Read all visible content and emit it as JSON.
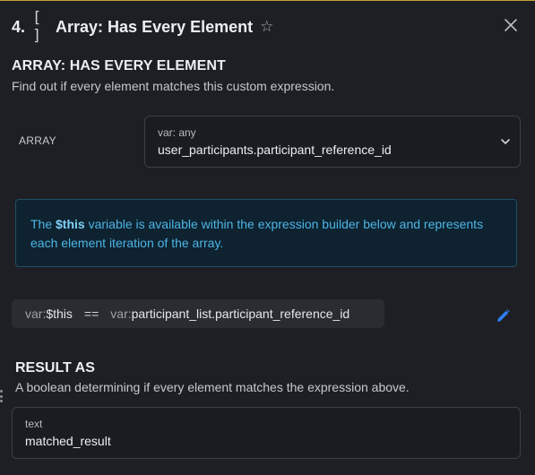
{
  "header": {
    "step_number": "4.",
    "bracket_icon": "[ ]",
    "title": "Array: Has Every Element",
    "star_icon": "star-outline-icon",
    "close_icon": "close-icon"
  },
  "section": {
    "title": "ARRAY: HAS EVERY ELEMENT",
    "description": "Find out if every element matches this custom expression."
  },
  "array_field": {
    "label": "ARRAY",
    "type_hint": "var: any",
    "value": "user_participants.participant_reference_id"
  },
  "info": {
    "prefix": "The ",
    "highlight": "$this",
    "suffix": " variable is available within the expression builder below and represents each element iteration of the array."
  },
  "expression": {
    "left_prefix": "var:",
    "left_value": "$this",
    "operator": "==",
    "right_prefix": "var:",
    "right_value": "participant_list.participant_reference_id"
  },
  "result": {
    "title": "RESULT AS",
    "description": "A boolean determining if every element matches the expression above.",
    "type_hint": "text",
    "value": "matched_result"
  },
  "colors": {
    "accent": "#2f7df6",
    "info_text": "#4db5e5",
    "info_bg": "#0e2230"
  }
}
